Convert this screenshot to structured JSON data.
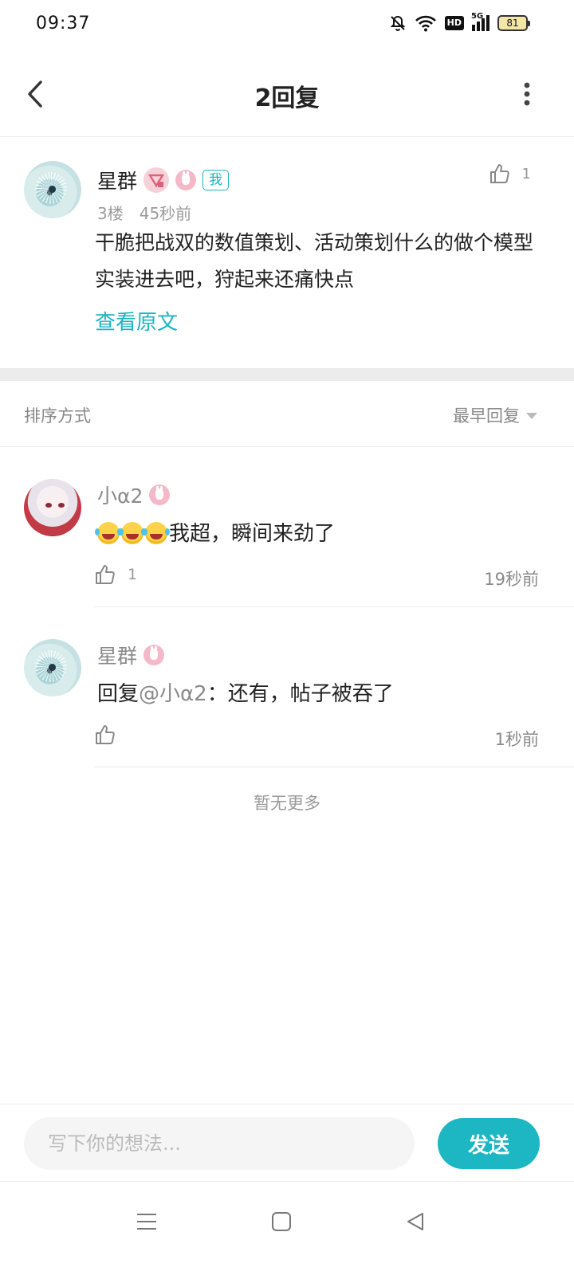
{
  "status_bar": {
    "time": "09:37",
    "hd": "HD",
    "network": "5G",
    "battery": "81"
  },
  "header": {
    "title": "2回复",
    "back_icon": "chevron-left-icon",
    "more_icon": "more-vertical-icon"
  },
  "main_comment": {
    "author": "星群",
    "me_tag": "我",
    "floor": "3楼",
    "time": "45秒前",
    "likes": "1",
    "text": "干脆把战双的数值策划、活动策划什么的做个模型实装进去吧，狩起来还痛快点",
    "view_original": "查看原文"
  },
  "sort": {
    "label": "排序方式",
    "selected": "最早回复"
  },
  "replies": [
    {
      "author": "小α2",
      "emoji_count": 3,
      "text": "我超，瞬间来劲了",
      "likes": "1",
      "time": "19秒前"
    },
    {
      "author": "星群",
      "prefix": "回复",
      "mention": "@小α2",
      "text": "：还有，帖子被吞了",
      "likes": "",
      "time": "1秒前"
    }
  ],
  "no_more": "暂无更多",
  "composer": {
    "placeholder": "写下你的想法...",
    "send_label": "发送"
  },
  "colors": {
    "accent": "#1db6c3",
    "text_primary": "#222222",
    "text_secondary": "#8a8a8a",
    "divider": "#ececec"
  }
}
